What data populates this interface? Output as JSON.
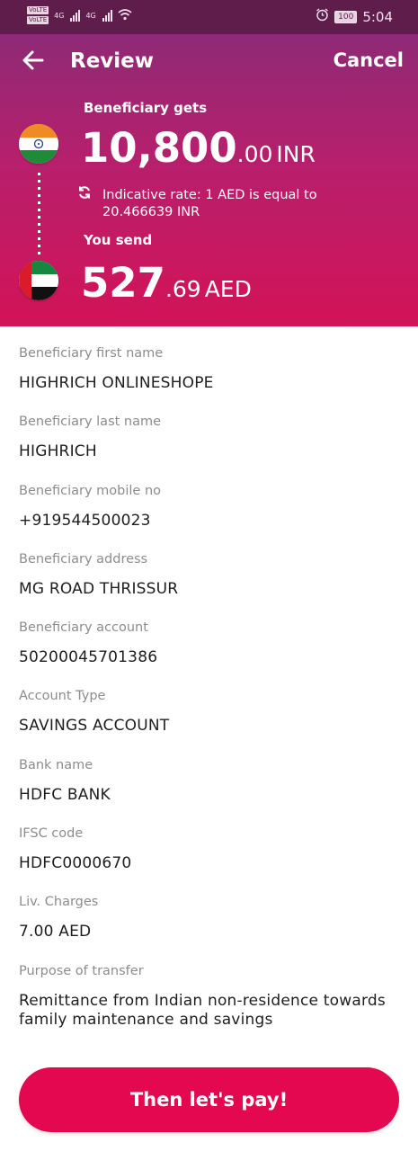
{
  "status_bar": {
    "sim1": "VoLTE",
    "sim2": "VoLTE",
    "network1": "4G",
    "network2": "4G",
    "battery": "100",
    "time": "5:04",
    "icons": [
      "signal-icon",
      "wifi-icon",
      "alarm-icon",
      "battery-icon"
    ]
  },
  "header": {
    "title": "Review",
    "cancel": "Cancel",
    "beneficiary_gets_label": "Beneficiary gets",
    "gets_amount_main": "10,800",
    "gets_amount_decimal": ".00",
    "gets_currency": "INR",
    "rate_text": "Indicative rate: 1 AED is equal to 20.466639 INR",
    "you_send_label": "You send",
    "send_amount_main": "527",
    "send_amount_decimal": ".69",
    "send_currency": "AED",
    "icons": [
      "back-arrow-icon",
      "india-flag-icon",
      "refresh-icon",
      "uae-flag-icon"
    ]
  },
  "details": [
    {
      "label": "Beneficiary first name",
      "value": "HIGHRICH ONLINESHOPE"
    },
    {
      "label": "Beneficiary last name",
      "value": "HIGHRICH"
    },
    {
      "label": "Beneficiary mobile no",
      "value": "+919544500023"
    },
    {
      "label": "Beneficiary address",
      "value": "MG ROAD THRISSUR"
    },
    {
      "label": "Beneficiary account",
      "value": "50200045701386"
    },
    {
      "label": "Account Type",
      "value": "SAVINGS ACCOUNT"
    },
    {
      "label": "Bank name",
      "value": "HDFC BANK"
    },
    {
      "label": "IFSC code",
      "value": "HDFC0000670"
    },
    {
      "label": "Liv. Charges",
      "value": "7.00 AED"
    },
    {
      "label": "Purpose of transfer",
      "value": "Remittance from Indian non-residence towards family maintenance and savings"
    }
  ],
  "pay_button": "Then let's pay!",
  "colors": {
    "status_bar": "#5e1d4a",
    "header_top": "#8e2a76",
    "header_bottom": "#d31357",
    "pay_button": "#e3084f",
    "label_gray": "#8c8c8c"
  }
}
